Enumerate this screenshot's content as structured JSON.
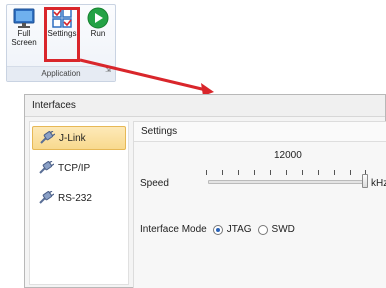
{
  "ribbon": {
    "group_label": "Application",
    "buttons": [
      {
        "label": "Full Screen",
        "icon": "monitor-icon"
      },
      {
        "label": "Settings",
        "icon": "settings-grid-icon"
      },
      {
        "label": "Run",
        "icon": "play-icon"
      }
    ]
  },
  "colors": {
    "highlight": "#d9262b",
    "selected_bg": "#f8d98e",
    "run_green": "#23a245"
  },
  "dialog": {
    "title": "Interfaces",
    "sidebar": [
      {
        "label": "J-Link",
        "icon": "plug-icon",
        "selected": true
      },
      {
        "label": "TCP/IP",
        "icon": "plug-icon",
        "selected": false
      },
      {
        "label": "RS-232",
        "icon": "plug-icon",
        "selected": false
      }
    ],
    "panel": {
      "title": "Settings",
      "speed_label": "Speed",
      "speed_value": "12000",
      "speed_unit": "kHz",
      "speed_level_fraction": 1.0,
      "interface_mode_label": "Interface Mode",
      "modes": [
        {
          "label": "JTAG",
          "checked": true
        },
        {
          "label": "SWD",
          "checked": false
        }
      ]
    }
  }
}
